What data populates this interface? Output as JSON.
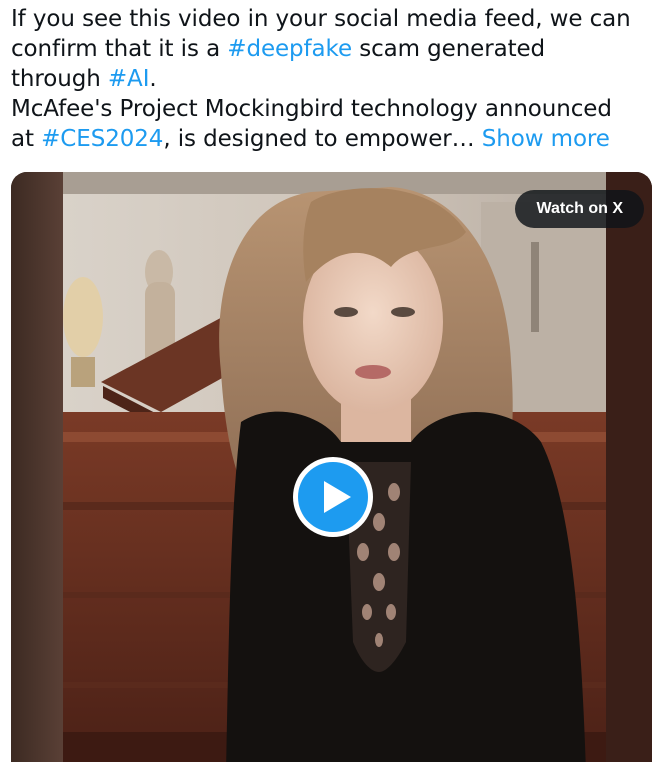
{
  "tweet": {
    "line1_pre": "If you see this video in your social media feed, we can confirm that it is a ",
    "hashtag_deepfake": "#deepfake",
    "line1_post": " scam generated through ",
    "hashtag_ai": "#AI",
    "line1_end": ".",
    "line2_pre": "McAfee's Project Mockingbird technology announced at ",
    "hashtag_ces": "#CES2024",
    "line2_post": ", is designed to empower… ",
    "show_more": "Show more"
  },
  "media": {
    "watch_label": "Watch on X",
    "play_icon": "play-icon"
  },
  "colors": {
    "link": "#1d9bf0",
    "text": "#0f1419",
    "pill_bg": "#0f1419",
    "play": "#1d9bf0"
  }
}
